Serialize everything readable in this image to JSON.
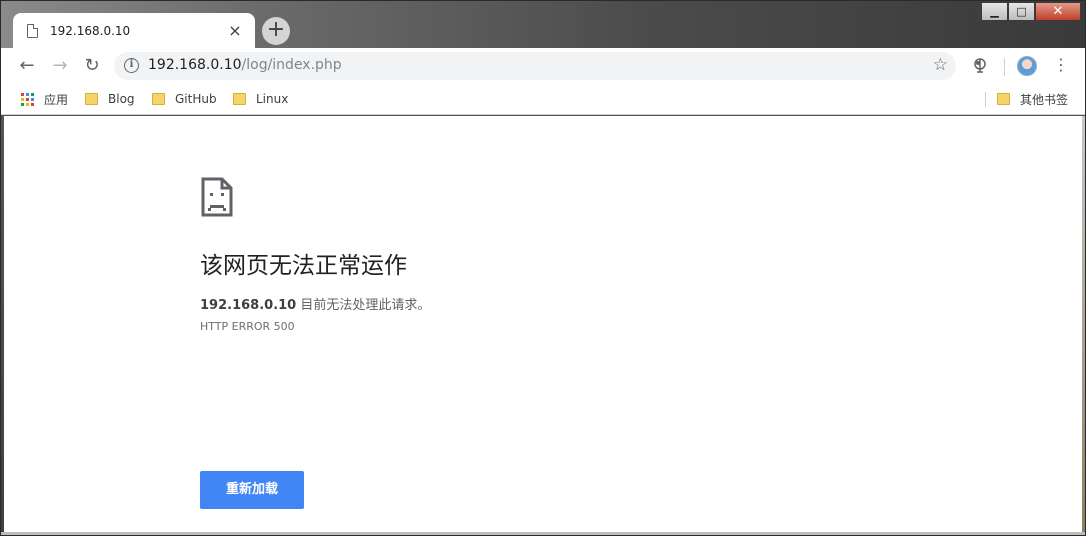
{
  "tab": {
    "title": "192.168.0.10",
    "close_label": "×",
    "new_tab_label": "+"
  },
  "window_controls": {
    "minimize": "▁",
    "maximize": "□",
    "close": "✕"
  },
  "toolbar": {
    "back_label": "←",
    "forward_label": "→",
    "reload_label": "↻",
    "info_label": "i",
    "url_host": "192.168.0.10",
    "url_path": "/log/index.php",
    "star_label": "☆",
    "menu_label": "⋮"
  },
  "bookmarks": {
    "apps_label": "应用",
    "items": [
      {
        "label": "Blog"
      },
      {
        "label": "GitHub"
      },
      {
        "label": "Linux"
      }
    ],
    "other_label": "其他书签",
    "apps_colors": [
      "#db4437",
      "#4285f4",
      "#0f9d58",
      "#f4b400",
      "#db4437",
      "#4285f4",
      "#0f9d58",
      "#f4b400",
      "#db4437"
    ]
  },
  "error_page": {
    "title": "该网页无法正常运作",
    "host": "192.168.0.10",
    "message": " 目前无法处理此请求。",
    "error_code": "HTTP ERROR 500",
    "reload_button": "重新加载",
    "button_color": "#4285f4"
  }
}
